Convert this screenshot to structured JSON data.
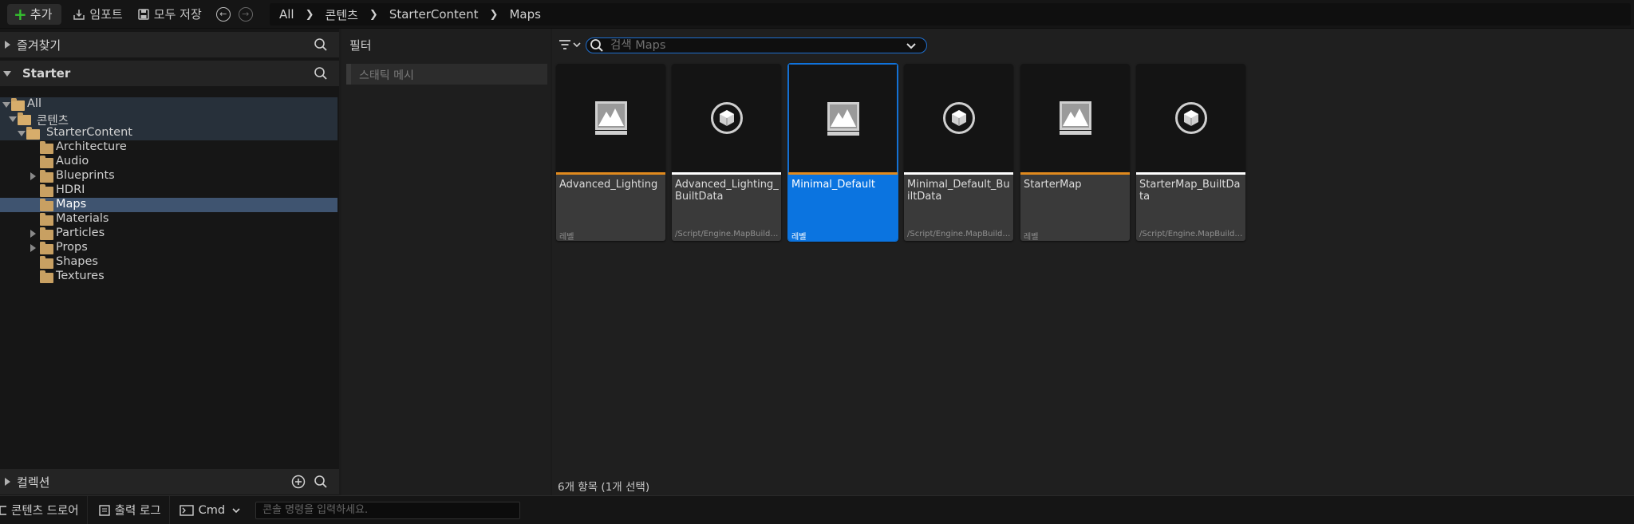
{
  "toolbar": {
    "add_label": "추가",
    "import_label": "임포트",
    "save_all_label": "모두 저장"
  },
  "breadcrumb": [
    "All",
    "콘텐츠",
    "StarterContent",
    "Maps"
  ],
  "left_panel": {
    "favorites_label": "즐겨찾기",
    "starter_label": "Starter",
    "collections_label": "컬렉션",
    "tree": [
      {
        "label": "All",
        "expanded": true,
        "selected": false
      },
      {
        "label": "콘텐츠",
        "expanded": true,
        "selected": false
      },
      {
        "label": "StarterContent",
        "expanded": true,
        "selected": false
      },
      {
        "label": "Architecture",
        "selected": false
      },
      {
        "label": "Audio",
        "selected": false
      },
      {
        "label": "Blueprints",
        "has_children": true,
        "selected": false
      },
      {
        "label": "HDRI",
        "selected": false
      },
      {
        "label": "Maps",
        "selected": true
      },
      {
        "label": "Materials",
        "selected": false
      },
      {
        "label": "Particles",
        "has_children": true,
        "selected": false
      },
      {
        "label": "Props",
        "has_children": true,
        "selected": false
      },
      {
        "label": "Shapes",
        "selected": false
      },
      {
        "label": "Textures",
        "selected": false
      }
    ]
  },
  "filter_panel": {
    "title": "필터",
    "items": [
      "스태틱 메시"
    ]
  },
  "content": {
    "search_placeholder": "검색 Maps",
    "assets": [
      {
        "name": "Advanced_Lighting",
        "type": "레벨",
        "icon": "level-map-icon",
        "bar_color": "#e08a1e",
        "selected": false
      },
      {
        "name": "Advanced_Lighting_BuiltData",
        "type": "/Script/Engine.MapBuildDataRegistry",
        "icon": "built-data-cube-icon",
        "bar_color": "#ffffff",
        "selected": false
      },
      {
        "name": "Minimal_Default",
        "type": "레벨",
        "icon": "level-map-icon",
        "bar_color": "#e08a1e",
        "selected": true
      },
      {
        "name": "Minimal_Default_BuiltData",
        "type": "/Script/Engine.MapBuildDataRegistry",
        "icon": "built-data-cube-icon",
        "bar_color": "#ffffff",
        "selected": false
      },
      {
        "name": "StarterMap",
        "type": "레벨",
        "icon": "level-map-icon",
        "bar_color": "#e08a1e",
        "selected": false
      },
      {
        "name": "StarterMap_BuiltData",
        "type": "/Script/Engine.MapBuildDataRegistry",
        "icon": "built-data-cube-icon",
        "bar_color": "#ffffff",
        "selected": false
      }
    ],
    "item_count": "6개 항목 (1개 선택)"
  },
  "bottom_bar": {
    "content_drawer_label": "콘텐츠 드로어",
    "output_log_label": "출력 로그",
    "cmd_label": "Cmd",
    "console_placeholder": "콘솔 명령을 입력하세요."
  },
  "colors": {
    "accent": "#0b74e0",
    "level_bar": "#e08a1e",
    "add_green": "#35c12f",
    "folder": "#c8a062"
  }
}
